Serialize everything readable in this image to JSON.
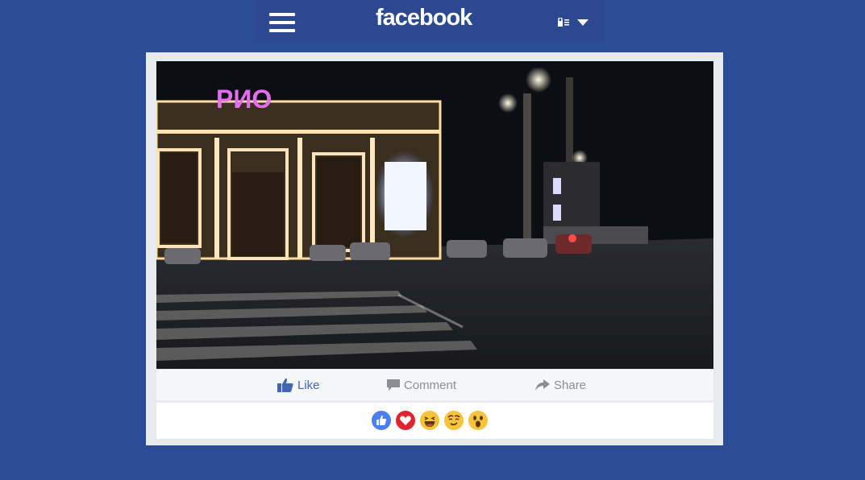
{
  "header": {
    "logo_text": "facebook",
    "menu_icon": "hamburger-menu-icon",
    "account_icon": "account-lock-icon",
    "dropdown_icon": "caret-down-icon"
  },
  "post": {
    "video_sign_text": "РИО",
    "actions": {
      "like_label": "Like",
      "comment_label": "Comment",
      "share_label": "Share"
    },
    "reactions": [
      "like-reaction",
      "love-reaction",
      "haha-reaction",
      "wow-reaction",
      "surprised-reaction"
    ]
  },
  "colors": {
    "background": "#2c4c96",
    "header": "#2b4890",
    "like_blue": "#4267b2",
    "love_red": "#e0242f",
    "reaction_yellow": "#f7c33b"
  }
}
